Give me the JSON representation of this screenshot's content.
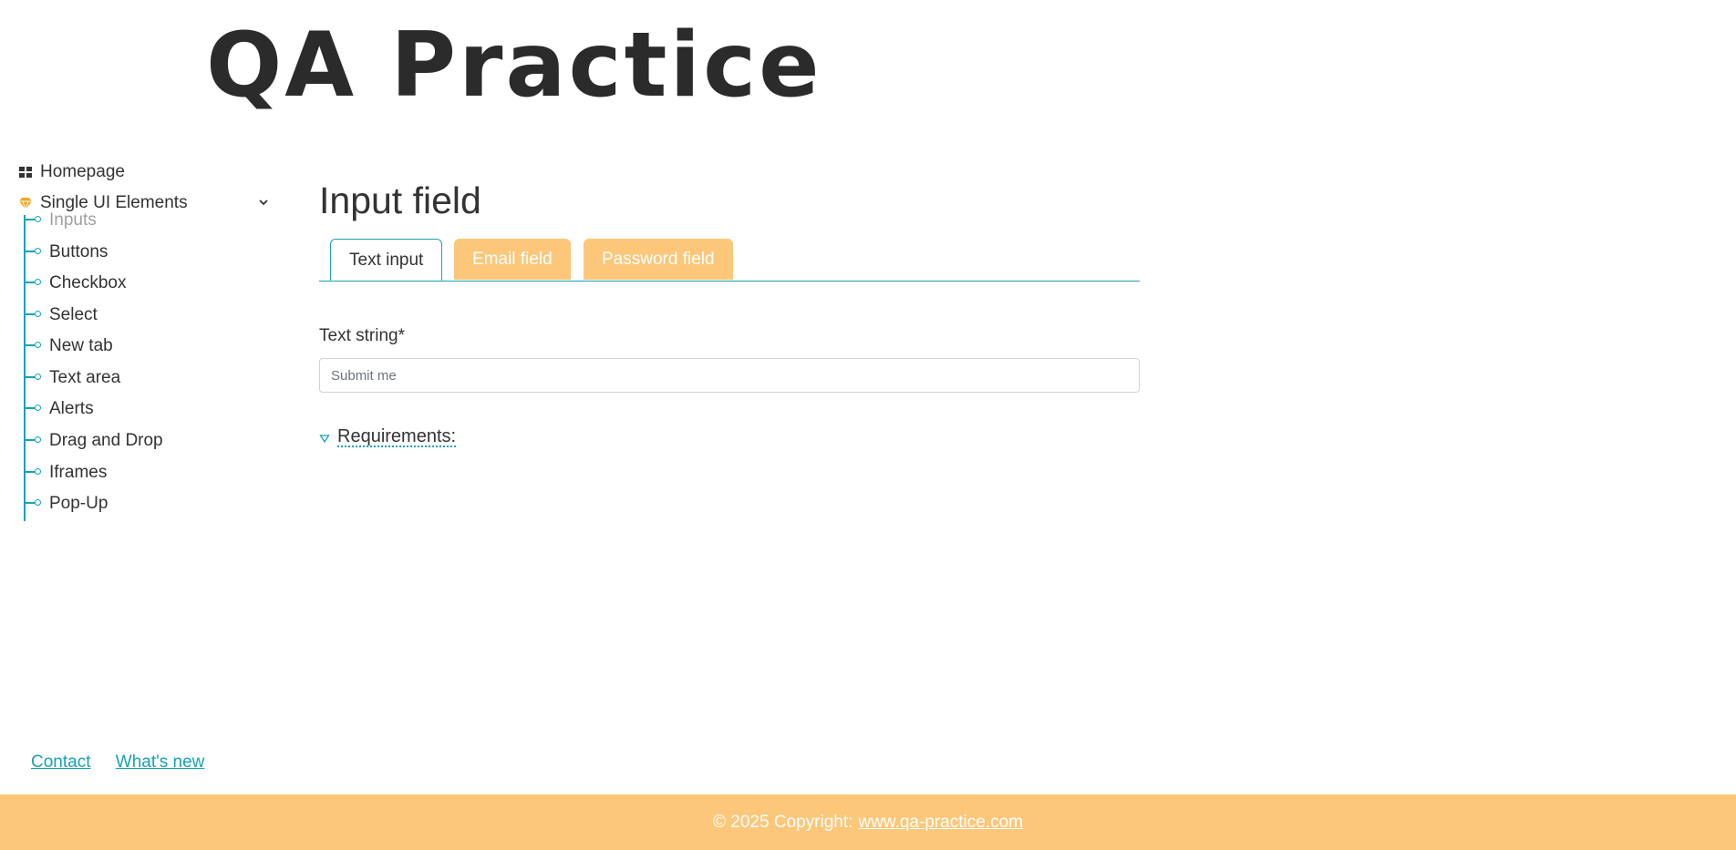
{
  "header": {
    "logo_text": "QA Practice"
  },
  "sidebar": {
    "homepage": {
      "label": "Homepage",
      "icon": "grid-icon"
    },
    "section": {
      "label": "Single UI Elements",
      "icon": "gem-icon",
      "expanded": true
    },
    "items": [
      {
        "label": "Inputs",
        "active": true
      },
      {
        "label": "Buttons",
        "active": false
      },
      {
        "label": "Checkbox",
        "active": false
      },
      {
        "label": "Select",
        "active": false
      },
      {
        "label": "New tab",
        "active": false
      },
      {
        "label": "Text area",
        "active": false
      },
      {
        "label": "Alerts",
        "active": false
      },
      {
        "label": "Drag and Drop",
        "active": false
      },
      {
        "label": "Iframes",
        "active": false
      },
      {
        "label": "Pop-Up",
        "active": false
      }
    ]
  },
  "main": {
    "title": "Input field",
    "tabs": [
      {
        "label": "Text input",
        "active": true
      },
      {
        "label": "Email field",
        "active": false
      },
      {
        "label": "Password field",
        "active": false
      }
    ],
    "field_label": "Text string*",
    "input_placeholder": "Submit me",
    "input_value": "",
    "requirements_label": "Requirements:"
  },
  "footer": {
    "links": [
      {
        "label": "Contact"
      },
      {
        "label": "What's new"
      }
    ],
    "copyright": "© 2025 Copyright:",
    "site_link": "www.qa-practice.com"
  },
  "colors": {
    "accent": "#17a2b8",
    "tab_inactive": "#fdc77a",
    "footer_bg": "#fdc77a",
    "text": "#333333"
  }
}
